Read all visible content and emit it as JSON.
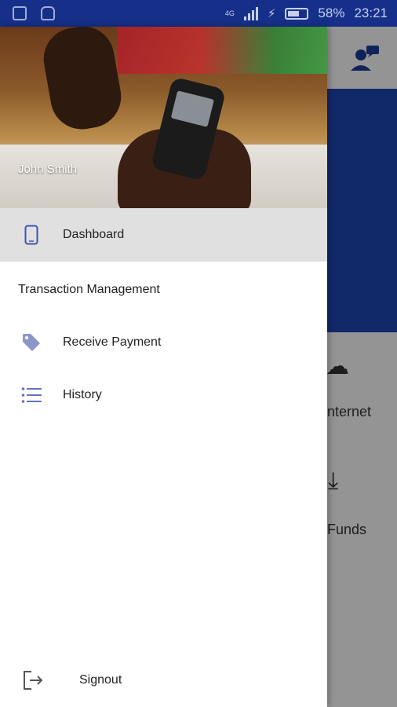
{
  "status_bar": {
    "network": "4G",
    "battery": "58%",
    "time": "23:21"
  },
  "background_app": {
    "tiles": [
      {
        "label": "nternet",
        "icon": "cloud-download-icon"
      },
      {
        "label": "Funds",
        "icon": "download-icon"
      }
    ]
  },
  "drawer": {
    "user_name": "John Smith",
    "items": [
      {
        "label": "Dashboard",
        "icon": "phone-icon",
        "active": true
      },
      {
        "label": "Receive Payment",
        "icon": "tag-icon"
      },
      {
        "label": "History",
        "icon": "list-icon"
      }
    ],
    "section_title": "Transaction Management",
    "signout_label": "Signout"
  },
  "colors": {
    "status_bar": "#16308a",
    "banner": "#1e46b5",
    "accent_icon": "#3f51b5"
  }
}
